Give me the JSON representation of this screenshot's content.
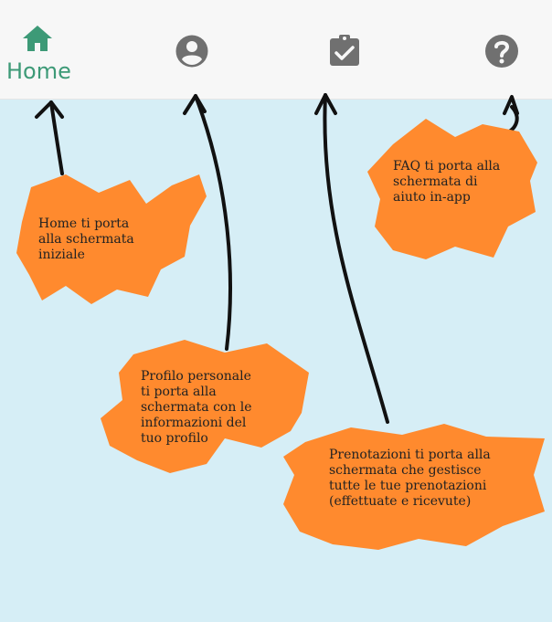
{
  "navbar": {
    "items": [
      {
        "name": "home",
        "icon": "home-icon",
        "label": "Home",
        "active": true
      },
      {
        "name": "profile",
        "icon": "account-circle-icon",
        "label": "",
        "active": false
      },
      {
        "name": "bookings",
        "icon": "clipboard-check-icon",
        "label": "",
        "active": false
      },
      {
        "name": "faq",
        "icon": "help-circle-icon",
        "label": "",
        "active": false
      }
    ]
  },
  "callouts": {
    "home": "Home ti porta\nalla schermata\niniziale",
    "faq": "FAQ ti porta alla\nschermata di\naiuto in-app",
    "profile": "Profilo personale\nti porta alla\nschermata con le\ninformazioni del\ntuo profilo",
    "bookings": "Prenotazioni ti porta alla\nschermata che gestisce\ntutte le tue prenotazioni\n(effettuate e ricevute)"
  },
  "colors": {
    "background": "#d6eef6",
    "navbar": "#f7f7f7",
    "accent": "#3d9a77",
    "icon_inactive": "#707070",
    "callout": "#ff8a2e",
    "arrow": "#111111"
  }
}
